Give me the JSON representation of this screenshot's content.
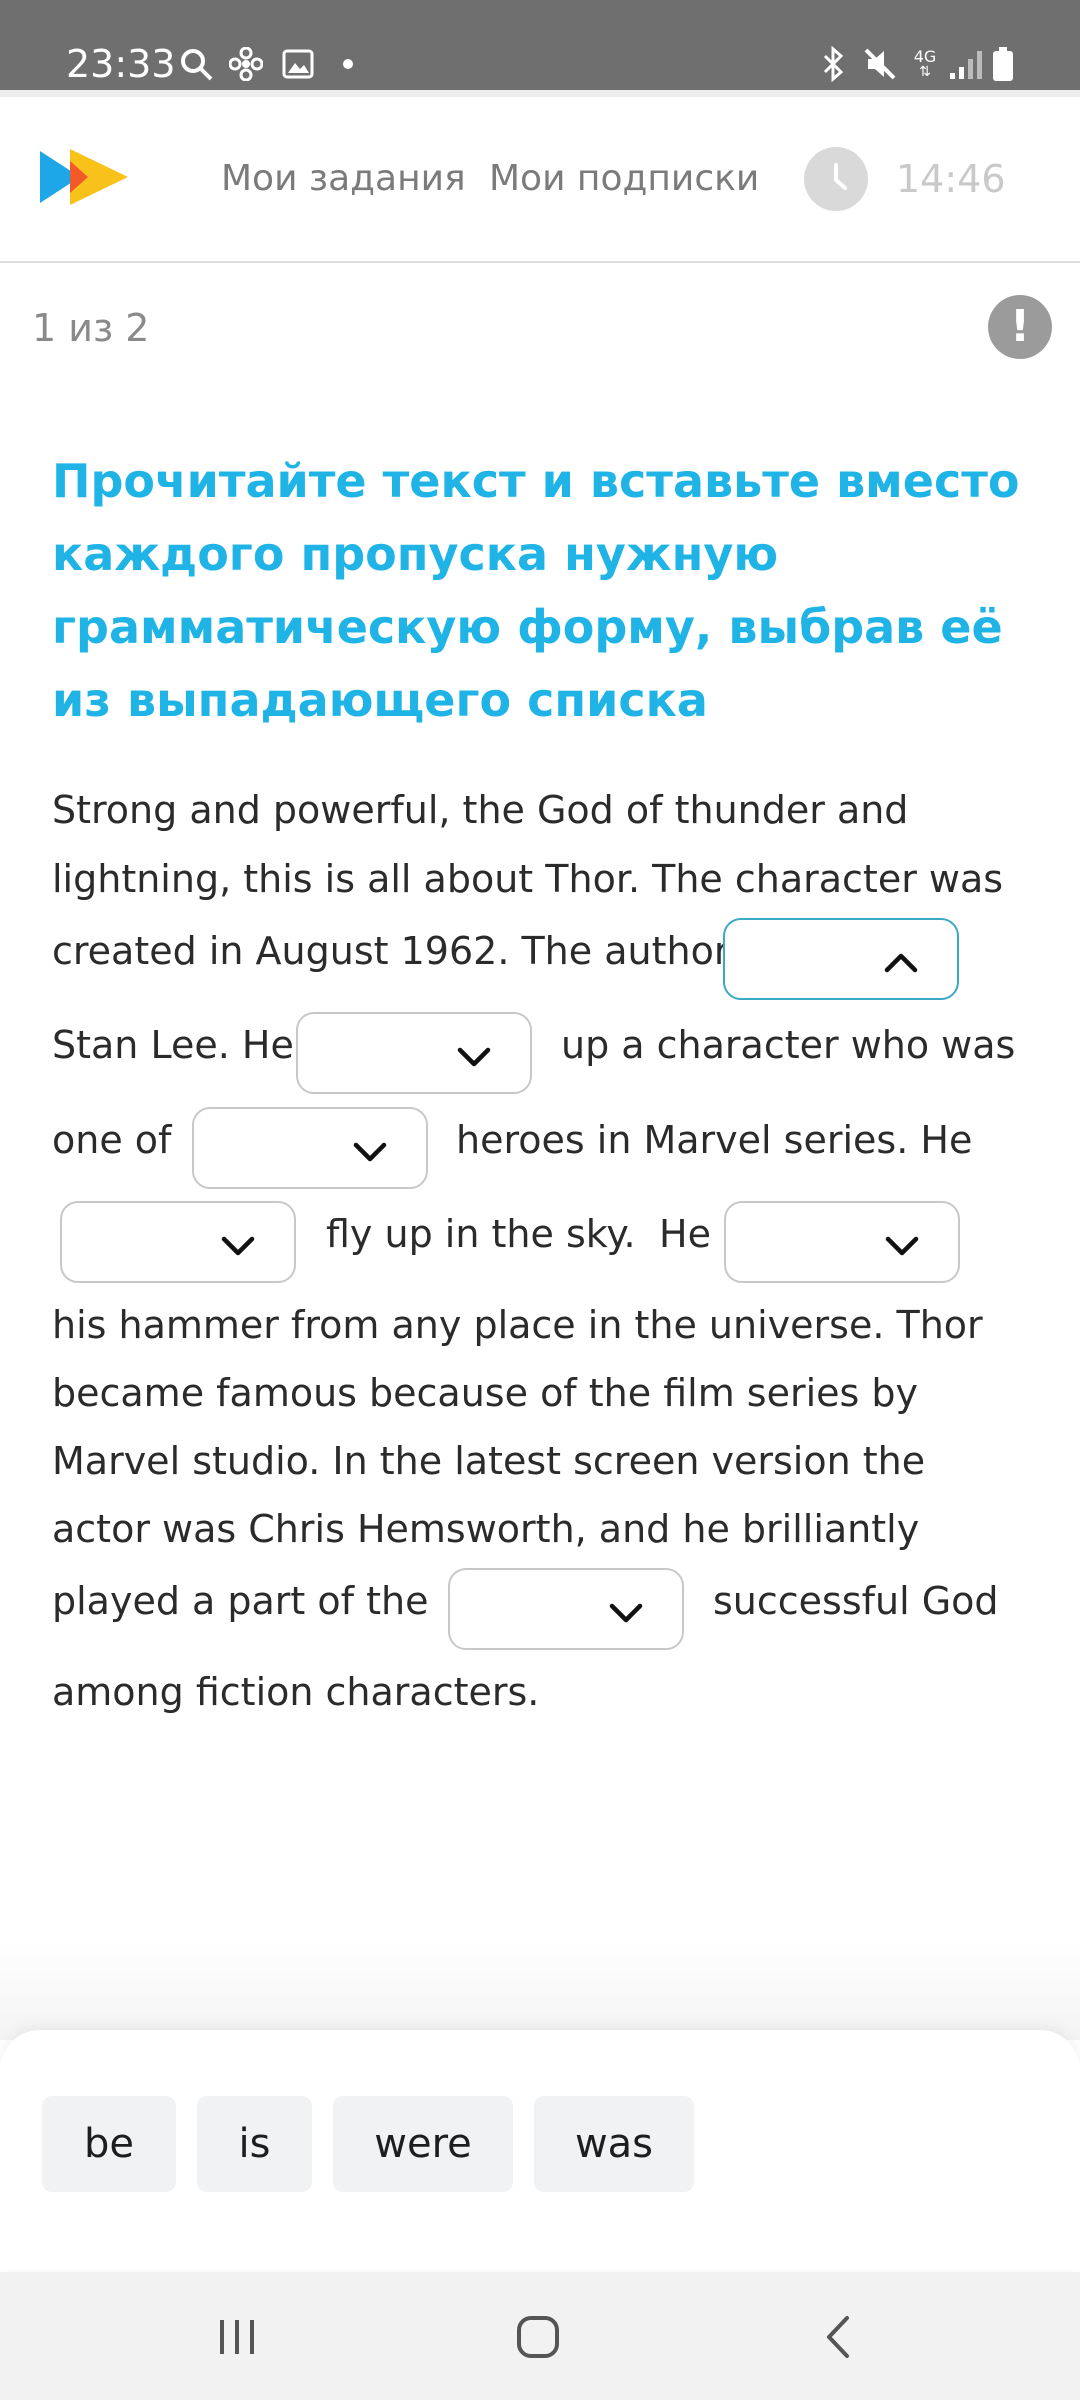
{
  "status_bar": {
    "time": "23:33",
    "left_icons": [
      "search-icon",
      "pinwheel-icon",
      "image-icon",
      "dot-icon"
    ],
    "right_icons": [
      "bluetooth-icon",
      "mute-icon",
      "4g-icon",
      "signal-icon",
      "battery-icon"
    ],
    "network": "4G"
  },
  "header": {
    "nav": [
      "Мои задания",
      "Мои подписки"
    ],
    "timer": "14:46"
  },
  "progress": {
    "counter": "1 из 2"
  },
  "task": {
    "title": "Прочитайте текст и вставьте вместо каждого пропуска нужную грамматическую форму, выбрав её из выпадающего списка",
    "segments": [
      "Strong and powerful, the God of thunder and",
      "lightning, this is all about Thor. The character was",
      "created in August 1962. The author",
      "Stan Lee. He",
      "up a character who was",
      "one of",
      "heroes in Marvel series. He",
      "fly up in the sky.",
      "He",
      "his hammer from any place in the universe. Thor",
      "became famous because of the film series by",
      "Marvel studio. In the latest screen version the",
      "actor was Chris Hemsworth, and he brilliantly",
      "played a part of the",
      "successful God",
      "among fiction characters."
    ]
  },
  "options": [
    "be",
    "is",
    "were",
    "was"
  ],
  "colors": {
    "accent": "#1fb3e6",
    "active_border": "#3ba9c4",
    "status_bar": "#6f6f6f",
    "chip_bg": "#f1f2f4"
  }
}
